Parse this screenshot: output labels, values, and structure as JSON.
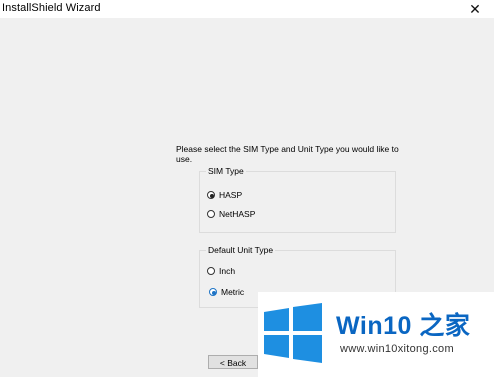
{
  "window": {
    "title": "InstallShield Wizard",
    "close_glyph": "✕"
  },
  "prompt": "Please select the SIM Type and Unit Type you would like to use.",
  "sim_type": {
    "title": "SIM Type",
    "options": [
      {
        "label": "HASP",
        "checked": true
      },
      {
        "label": "NetHASP",
        "checked": false
      }
    ]
  },
  "unit_type": {
    "title": "Default Unit Type",
    "options": [
      {
        "label": "Inch",
        "checked": false
      },
      {
        "label": "Metric",
        "checked": true
      }
    ]
  },
  "buttons": {
    "back": "< Back"
  },
  "watermark": {
    "title": "Win10 之家",
    "url": "www.win10xitong.com",
    "logo_color": "#1e8fe1"
  }
}
